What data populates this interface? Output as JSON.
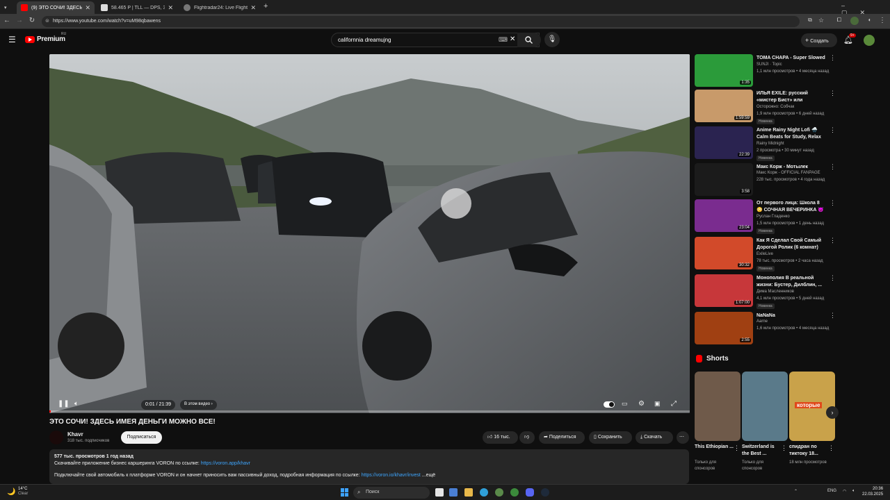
{
  "browser": {
    "tabs": [
      {
        "title": "(9) ЭТО СОЧИ! ЗДЕСЬ ИМЕ...",
        "active": true
      },
      {
        "title": "58.465 P | TLL — DPS, 30.03",
        "active": false
      },
      {
        "title": "Flightradar24: Live Flight Track...",
        "active": false
      }
    ],
    "url": "https://www.youtube.com/watch?v=uM98qbawens"
  },
  "header": {
    "logo_text": "Premium",
    "search_value": "californnia dreamujng",
    "create_label": "Создать",
    "notif_count": "9+"
  },
  "video": {
    "time": "0:01 / 21:39",
    "chapter": "В этом видео",
    "title": "ЭТО СОЧИ! ЗДЕСЬ ИМЕЯ ДЕНЬГИ МОЖНО ВСЕ!",
    "progress": 0.001
  },
  "channel": {
    "name": "Khavr",
    "subs": "318 тыс. подписчиков",
    "subscribe_label": "Подписаться"
  },
  "actions": {
    "likes": "16 тыс.",
    "share": "Поделиться",
    "save": "Сохранить",
    "download": "Скачать",
    "more": "⋯"
  },
  "description": {
    "meta": "577 тыс. просмотров  1 год назад",
    "line1": "Скачивайте приложение бизнес каршеринга VORON по ссылке: ",
    "link1": "https://voron.app/khavr",
    "line2": "Подключайте свой автомобиль к платформе VORON и он начнет приносить вам пассивный доход, подробная информация по ссылке: ",
    "link2": "https://voron.io/khavr/invest",
    "more": "...ещё"
  },
  "recommendations": [
    {
      "title": "TOMA CHAPA - Super Slowed",
      "channel": "SUNJI · Topic",
      "meta": "1,1 млн просмотров • 4 месяца назад",
      "duration": "1:35",
      "badge": "",
      "thumb_color": "#2b9b3a",
      "verified": false
    },
    {
      "title": "ИЛЬЯ EXILE: русский «мистер Бист» или талантливый ...",
      "channel": "Осторожно: Собчак",
      "meta": "1,9 млн просмотров • 6 дней назад",
      "duration": "1:59:59",
      "badge": "Новинка",
      "thumb_color": "#c89a6a",
      "verified": true
    },
    {
      "title": "Anime Rainy Night Lofi 🌧️ Calm Beats for Study, Relax and ...",
      "channel": "Rainy Midnight",
      "meta": "2 просмотра • 30 минут назад",
      "duration": "22:39",
      "badge": "Новинка",
      "thumb_color": "#2a2350",
      "verified": false
    },
    {
      "title": "Макс Корж - Мотылек",
      "channel": "Макс Корж - OFFICIAL FANPAGE",
      "meta": "228 тыс. просмотров • 4 года назад",
      "duration": "3:58",
      "badge": "",
      "thumb_color": "#1b1b1b",
      "verified": true
    },
    {
      "title": "От первого лица: Школа 8 😳 СОЧНАЯ ВЕЧЕРИНКА 😈 ...",
      "channel": "Руслан Гладенко",
      "meta": "1,5 млн просмотров • 1 день назад",
      "duration": "23:04",
      "badge": "Новинка",
      "thumb_color": "#7a2c8f",
      "verified": true
    },
    {
      "title": "Как Я Сделал Свой Самый Дорогой Ролик (6 комнат)",
      "channel": "ExileLive",
      "meta": "78 тыс. просмотров • 2 часа назад",
      "duration": "30:32",
      "badge": "Новинка",
      "thumb_color": "#d24a2a",
      "verified": true
    },
    {
      "title": "Монополия В реальной жизни: Бустер, Дилблин, ...",
      "channel": "Дима Масленников",
      "meta": "4,1 млн просмотров • 5 дней назад",
      "duration": "1:07:00",
      "badge": "Новинка",
      "thumb_color": "#c7373a",
      "verified": true
    },
    {
      "title": "NaNaNa",
      "channel": "Aarne",
      "meta": "1,6 млн просмотров • 4 месяца назад",
      "duration": "2:55",
      "badge": "",
      "thumb_color": "#a04012",
      "verified": true
    }
  ],
  "shorts": {
    "heading": "Shorts",
    "items": [
      {
        "title": "This Ethiopian ...",
        "meta": "Только для спонсоров",
        "color": "#6f5a4a"
      },
      {
        "title": "Switzerland is the Best ...",
        "meta": "Только для спонсоров",
        "color": "#5a7a8a"
      },
      {
        "title": "спидран по тиктоку 18...",
        "meta": "18 млн просмотров",
        "color": "#c9a24a",
        "caption": "которые"
      }
    ]
  },
  "taskbar": {
    "weather_temp": "14°C",
    "weather_desc": "Clear",
    "search": "Поиск",
    "lang": "ENG",
    "time": "20:36",
    "date": "22.03.2025"
  },
  "colors": {
    "accent": "#ff0000",
    "link": "#3ea6ff",
    "bg": "#0f0f0f"
  }
}
